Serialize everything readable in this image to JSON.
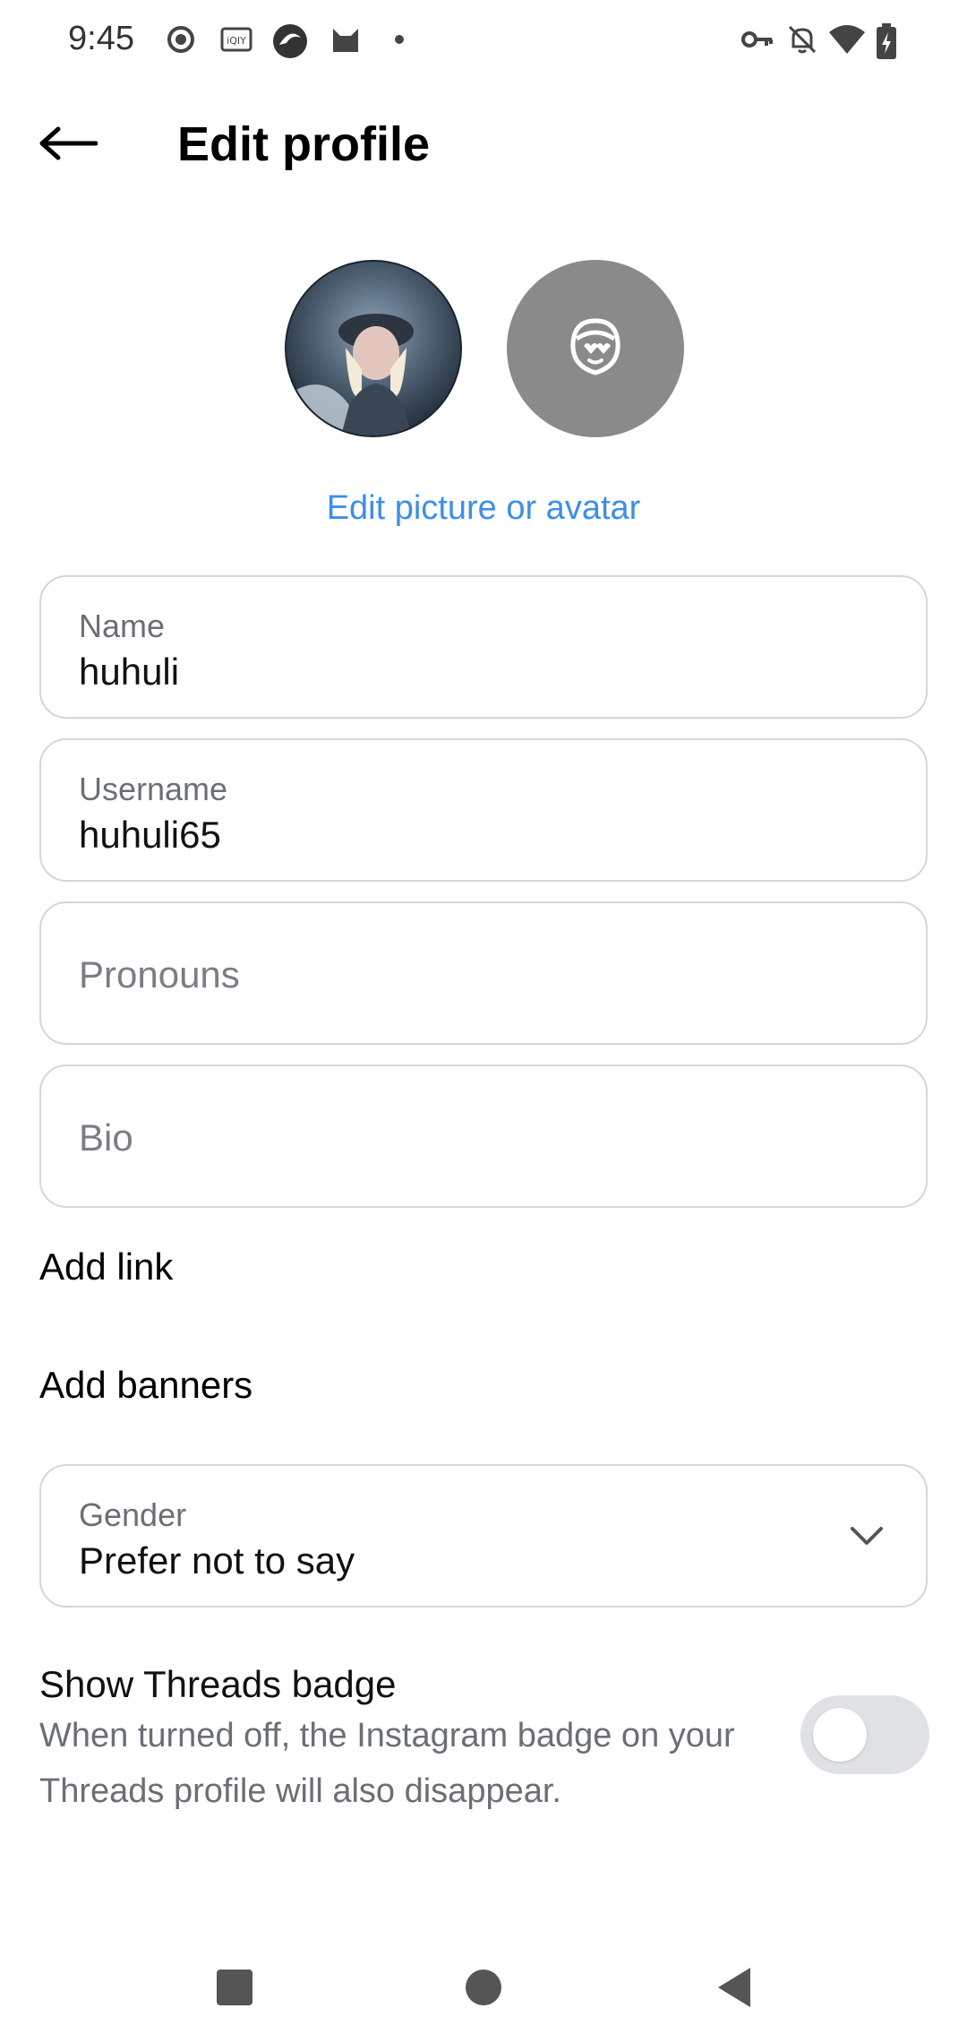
{
  "status_bar": {
    "time": "9:45",
    "left_icons": [
      "record-icon",
      "iqiyi-icon",
      "browser-icon",
      "cat-icon",
      "dot-icon"
    ],
    "right_icons": [
      "vpn-key-icon",
      "bell-off-icon",
      "wifi-icon",
      "battery-charging-icon"
    ]
  },
  "header": {
    "title": "Edit profile",
    "back_icon": "arrow-left-icon"
  },
  "avatar_section": {
    "photo_icon": "profile-photo",
    "avatar_icon": "avatar-face-icon",
    "edit_link": "Edit picture or avatar"
  },
  "fields": {
    "name": {
      "label": "Name",
      "value": "huhuli"
    },
    "username": {
      "label": "Username",
      "value": "huhuli65"
    },
    "pronouns": {
      "placeholder": "Pronouns"
    },
    "bio": {
      "placeholder": "Bio"
    }
  },
  "links": {
    "add_link": "Add link",
    "add_banners": "Add banners"
  },
  "gender": {
    "label": "Gender",
    "value": "Prefer not to say",
    "icon": "chevron-down-icon"
  },
  "threads_badge": {
    "title": "Show Threads badge",
    "description": "When turned off, the Instagram badge on your Threads profile will also disappear.",
    "enabled": false
  },
  "nav_bar": {
    "icons": [
      "recents-square-icon",
      "home-circle-icon",
      "back-triangle-icon"
    ]
  },
  "colors": {
    "accent": "#3d8fe6",
    "border": "#d4d6da",
    "secondary_text": "#6b6f75",
    "toggle_off": "#dfe1e4"
  }
}
